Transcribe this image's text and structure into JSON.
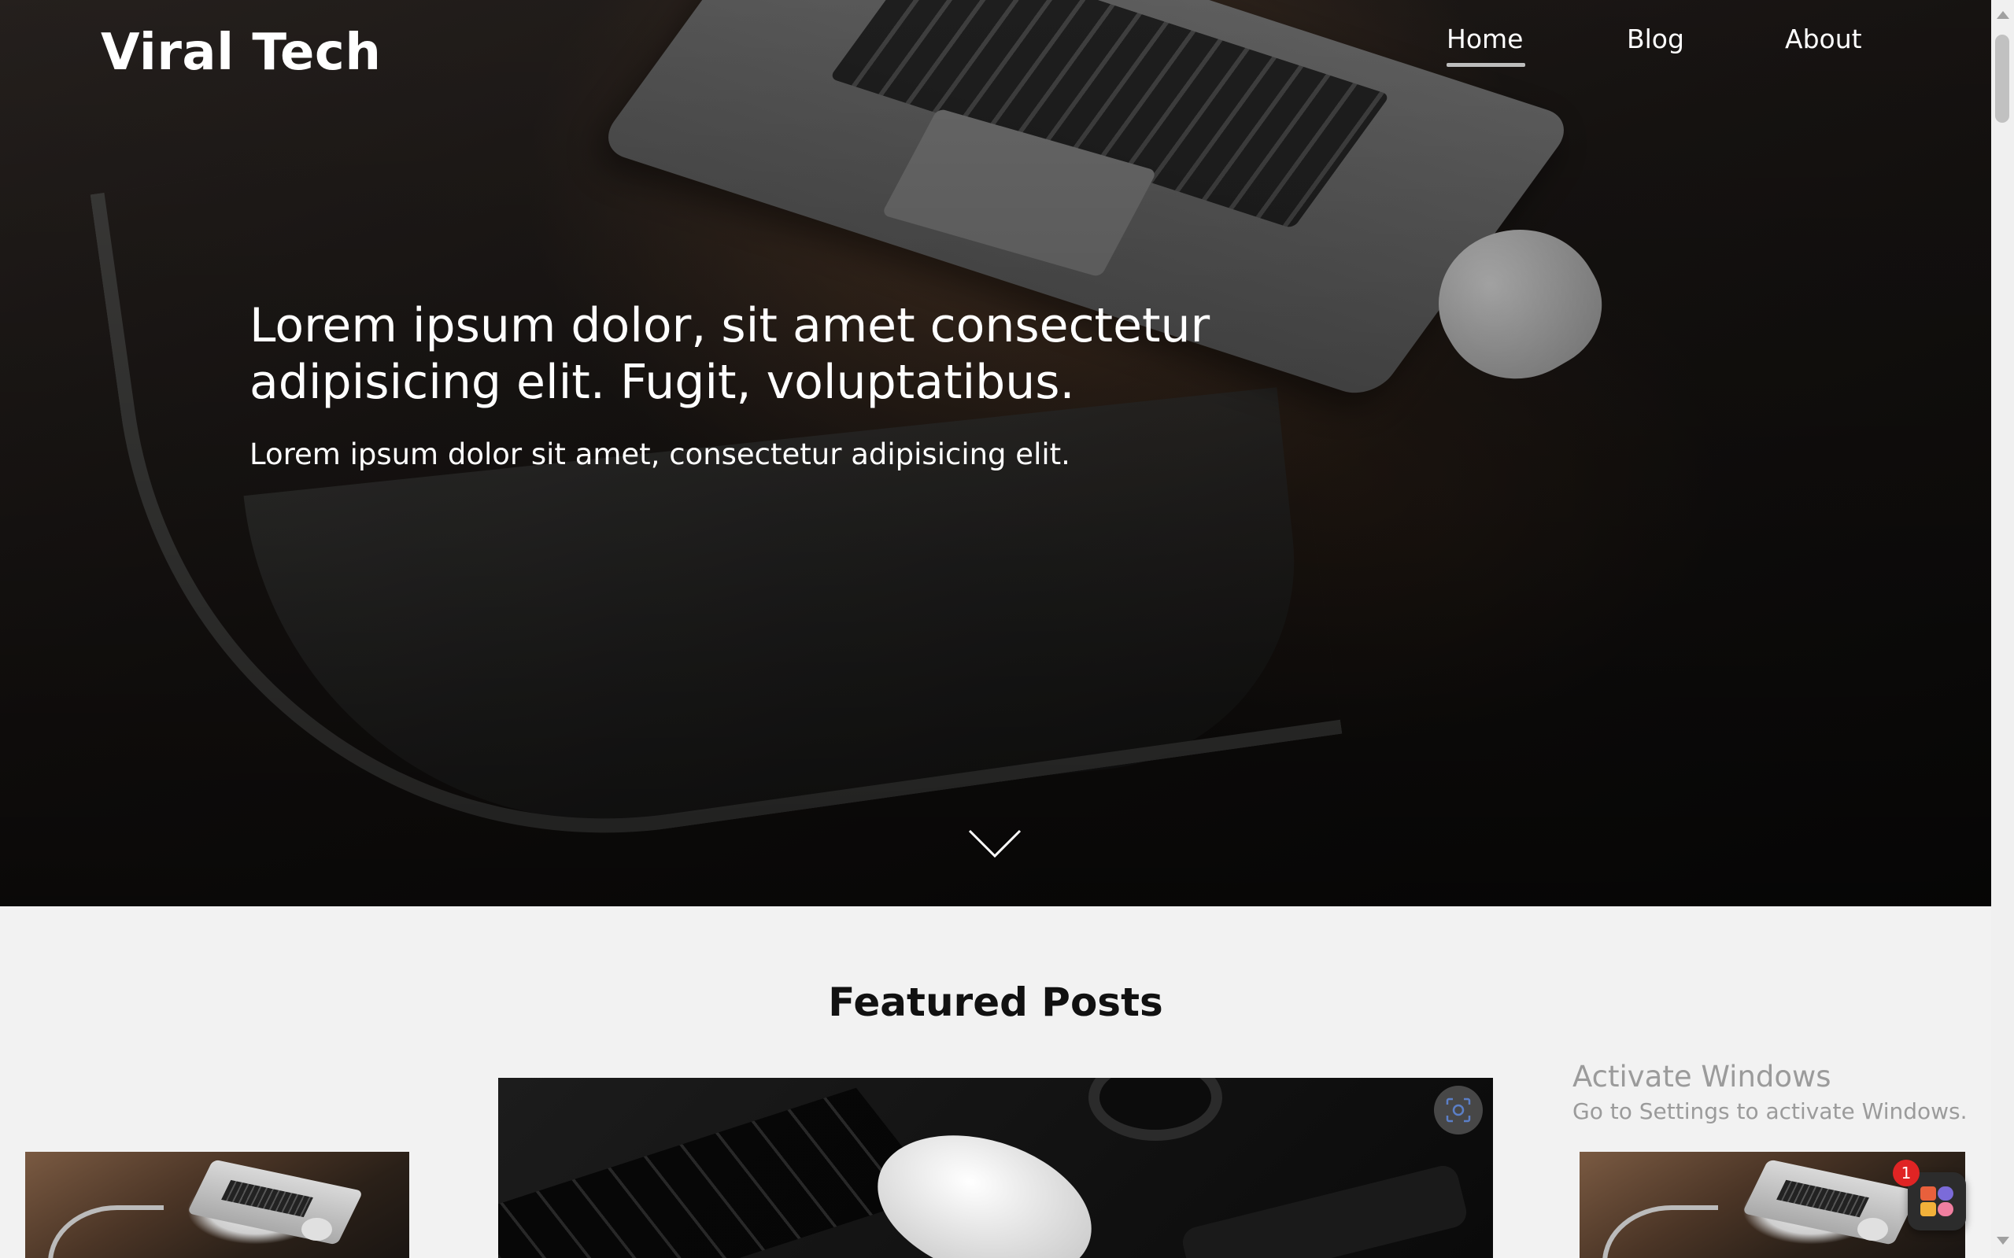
{
  "brand": "Viral Tech",
  "nav": {
    "home": "Home",
    "blog": "Blog",
    "about": "About",
    "active": "Home"
  },
  "hero": {
    "title": "Lorem ipsum dolor, sit amet consectetur adipisicing elit. Fugit, voluptatibus.",
    "subtitle": "Lorem ipsum dolor sit amet, consectetur adipisicing elit."
  },
  "featured": {
    "heading": "Featured Posts"
  },
  "watermark": {
    "title": "Activate Windows",
    "subtitle": "Go to Settings to activate Windows."
  },
  "widget": {
    "badge_count": "1"
  },
  "icons": {
    "scroll": "chevron-down-icon",
    "lens": "visual-search-icon"
  },
  "colors": {
    "hero_text": "#ffffff",
    "section_bg": "#f2f2f2",
    "heading_text": "#111111",
    "badge": "#e02424"
  }
}
